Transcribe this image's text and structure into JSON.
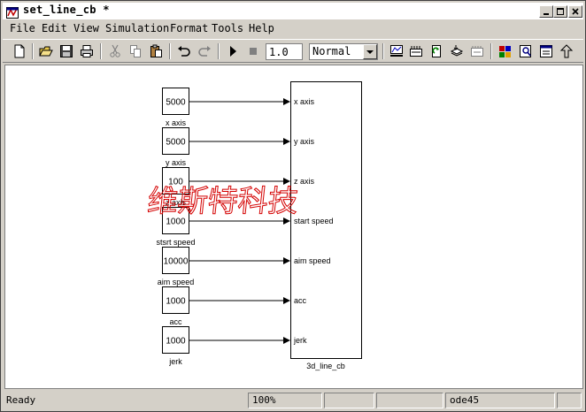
{
  "window": {
    "title": "set_line_cb *"
  },
  "menu": {
    "items": [
      "File",
      "Edit",
      "View",
      "Simulation",
      "Format",
      "Tools",
      "Help"
    ]
  },
  "toolbar": {
    "stop_time": "1.0",
    "sim_mode": "Normal",
    "icons": [
      "new-model-icon",
      "open-icon",
      "save-icon",
      "print-icon",
      "cut-icon",
      "copy-icon",
      "paste-icon",
      "undo-icon",
      "redo-icon",
      "start-simulation-icon",
      "stop-simulation-icon",
      "build-icon",
      "update-diagram-icon",
      "model-explorer-icon",
      "library-browser-icon",
      "debug-icon",
      "library-icon",
      "find-icon",
      "model-properties-icon",
      "go-to-parent-icon"
    ]
  },
  "diagram": {
    "inputs": [
      {
        "value": "5000",
        "label": "x axis"
      },
      {
        "value": "5000",
        "label": "y axis"
      },
      {
        "value": "100",
        "label": "z axis"
      },
      {
        "value": "1000",
        "label": "stsrt speed"
      },
      {
        "value": "10000",
        "label": "aim speed"
      },
      {
        "value": "1000",
        "label": "acc"
      },
      {
        "value": "1000",
        "label": "jerk"
      }
    ],
    "ports": [
      "x axis",
      "y axis",
      "z axis",
      "start speed",
      "aim speed",
      "acc",
      "jerk"
    ],
    "subsystem_name": "3d_line_cb",
    "watermark": "维斯特科技"
  },
  "status": {
    "text": "Ready",
    "zoom": "100%",
    "solver": "ode45"
  },
  "colors": {
    "chrome": "#d4d0c8",
    "canvas": "#ffffff",
    "watermark": "#d40000"
  }
}
